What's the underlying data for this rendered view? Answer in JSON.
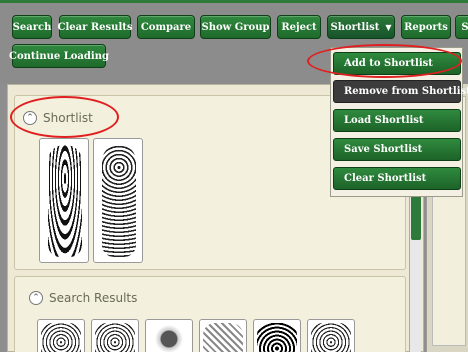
{
  "toolbar": {
    "search": "Search",
    "clear_results": "Clear Results",
    "compare": "Compare",
    "show_group": "Show Group",
    "reject": "Reject",
    "shortlist": "Shortlist",
    "reports": "Reports",
    "overflow": "S",
    "continue_loading": "Continue Loading"
  },
  "shortlist_menu": {
    "items": [
      "Add to Shortlist",
      "Remove from Shortlist",
      "Load Shortlist",
      "Save Shortlist",
      "Clear Shortlist"
    ]
  },
  "panels": {
    "shortlist_title": "Shortlist",
    "search_results_title": "Search Results"
  },
  "colors": {
    "accent": "#2d7a3a",
    "highlight": "#e02020"
  }
}
